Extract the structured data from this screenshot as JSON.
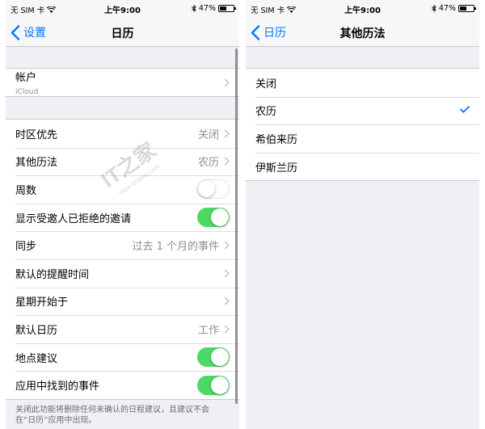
{
  "status": {
    "carrier": "无 SIM 卡",
    "time": "上午9:00",
    "battery": "47%"
  },
  "left": {
    "back_label": "设置",
    "title": "日历",
    "account": {
      "label": "帐户",
      "sub": "iCloud"
    },
    "rows": [
      {
        "label": "时区优先",
        "value": "关闭"
      },
      {
        "label": "其他历法",
        "value": "农历"
      },
      {
        "label": "周数",
        "toggle": "off"
      },
      {
        "label": "显示受邀人已拒绝的邀请",
        "toggle": "on"
      },
      {
        "label": "同步",
        "value": "过去 1 个月的事件"
      },
      {
        "label": "默认的提醒时间"
      },
      {
        "label": "星期开始于"
      },
      {
        "label": "默认日历",
        "value": "工作"
      },
      {
        "label": "地点建议",
        "toggle": "on"
      },
      {
        "label": "应用中找到的事件",
        "toggle": "on"
      }
    ],
    "footer": "关闭此功能将删除任何未确认的日程建议，且建议不会在“日历”应用中出现。"
  },
  "right": {
    "back_label": "日历",
    "title": "其他历法",
    "options": [
      {
        "label": "关闭",
        "selected": false
      },
      {
        "label": "农历",
        "selected": true
      },
      {
        "label": "希伯来历",
        "selected": false
      },
      {
        "label": "伊斯兰历",
        "selected": false
      }
    ]
  },
  "watermark": {
    "brand": "IT之家",
    "url": "www.ithome.com"
  },
  "colors": {
    "accent": "#007aff",
    "toggle_on": "#4cd964",
    "background": "#efeff4"
  }
}
